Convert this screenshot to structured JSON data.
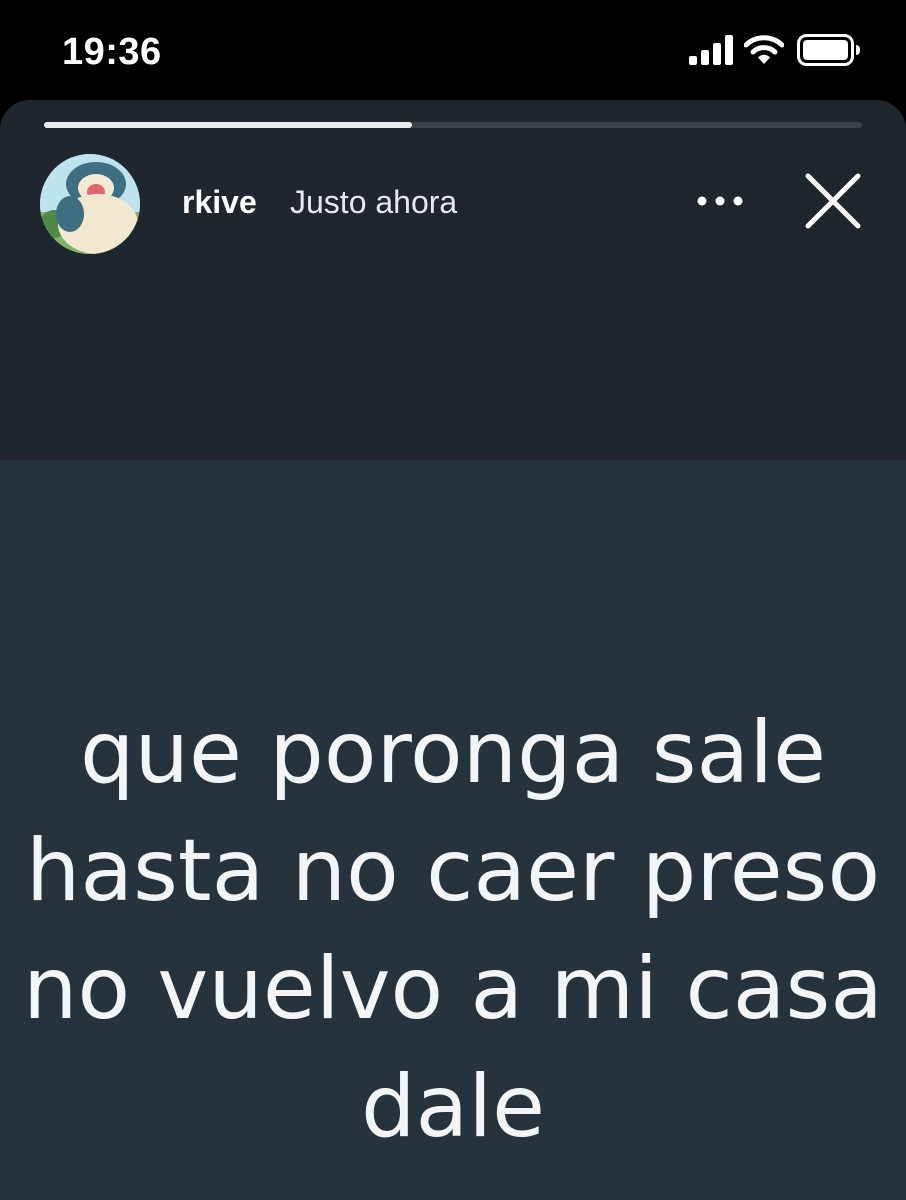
{
  "status_bar": {
    "time": "19:36",
    "signal_bars": 4,
    "wifi": "wifi-icon",
    "battery": "battery-full-icon"
  },
  "story": {
    "progress": 0.45,
    "username": "rkive",
    "timestamp": "Justo ahora",
    "avatar": "snorlax-avatar",
    "lines": [
      "que poronga sale",
      "hasta no caer preso",
      "no vuelvo a mi casa",
      "dale"
    ]
  },
  "colors": {
    "background": "#000000",
    "story_top": "#1f262d",
    "story_body": "#26333d",
    "text": "#f3f4f5",
    "progress_fill": "#e9ebed",
    "progress_track": "#3a4249"
  }
}
